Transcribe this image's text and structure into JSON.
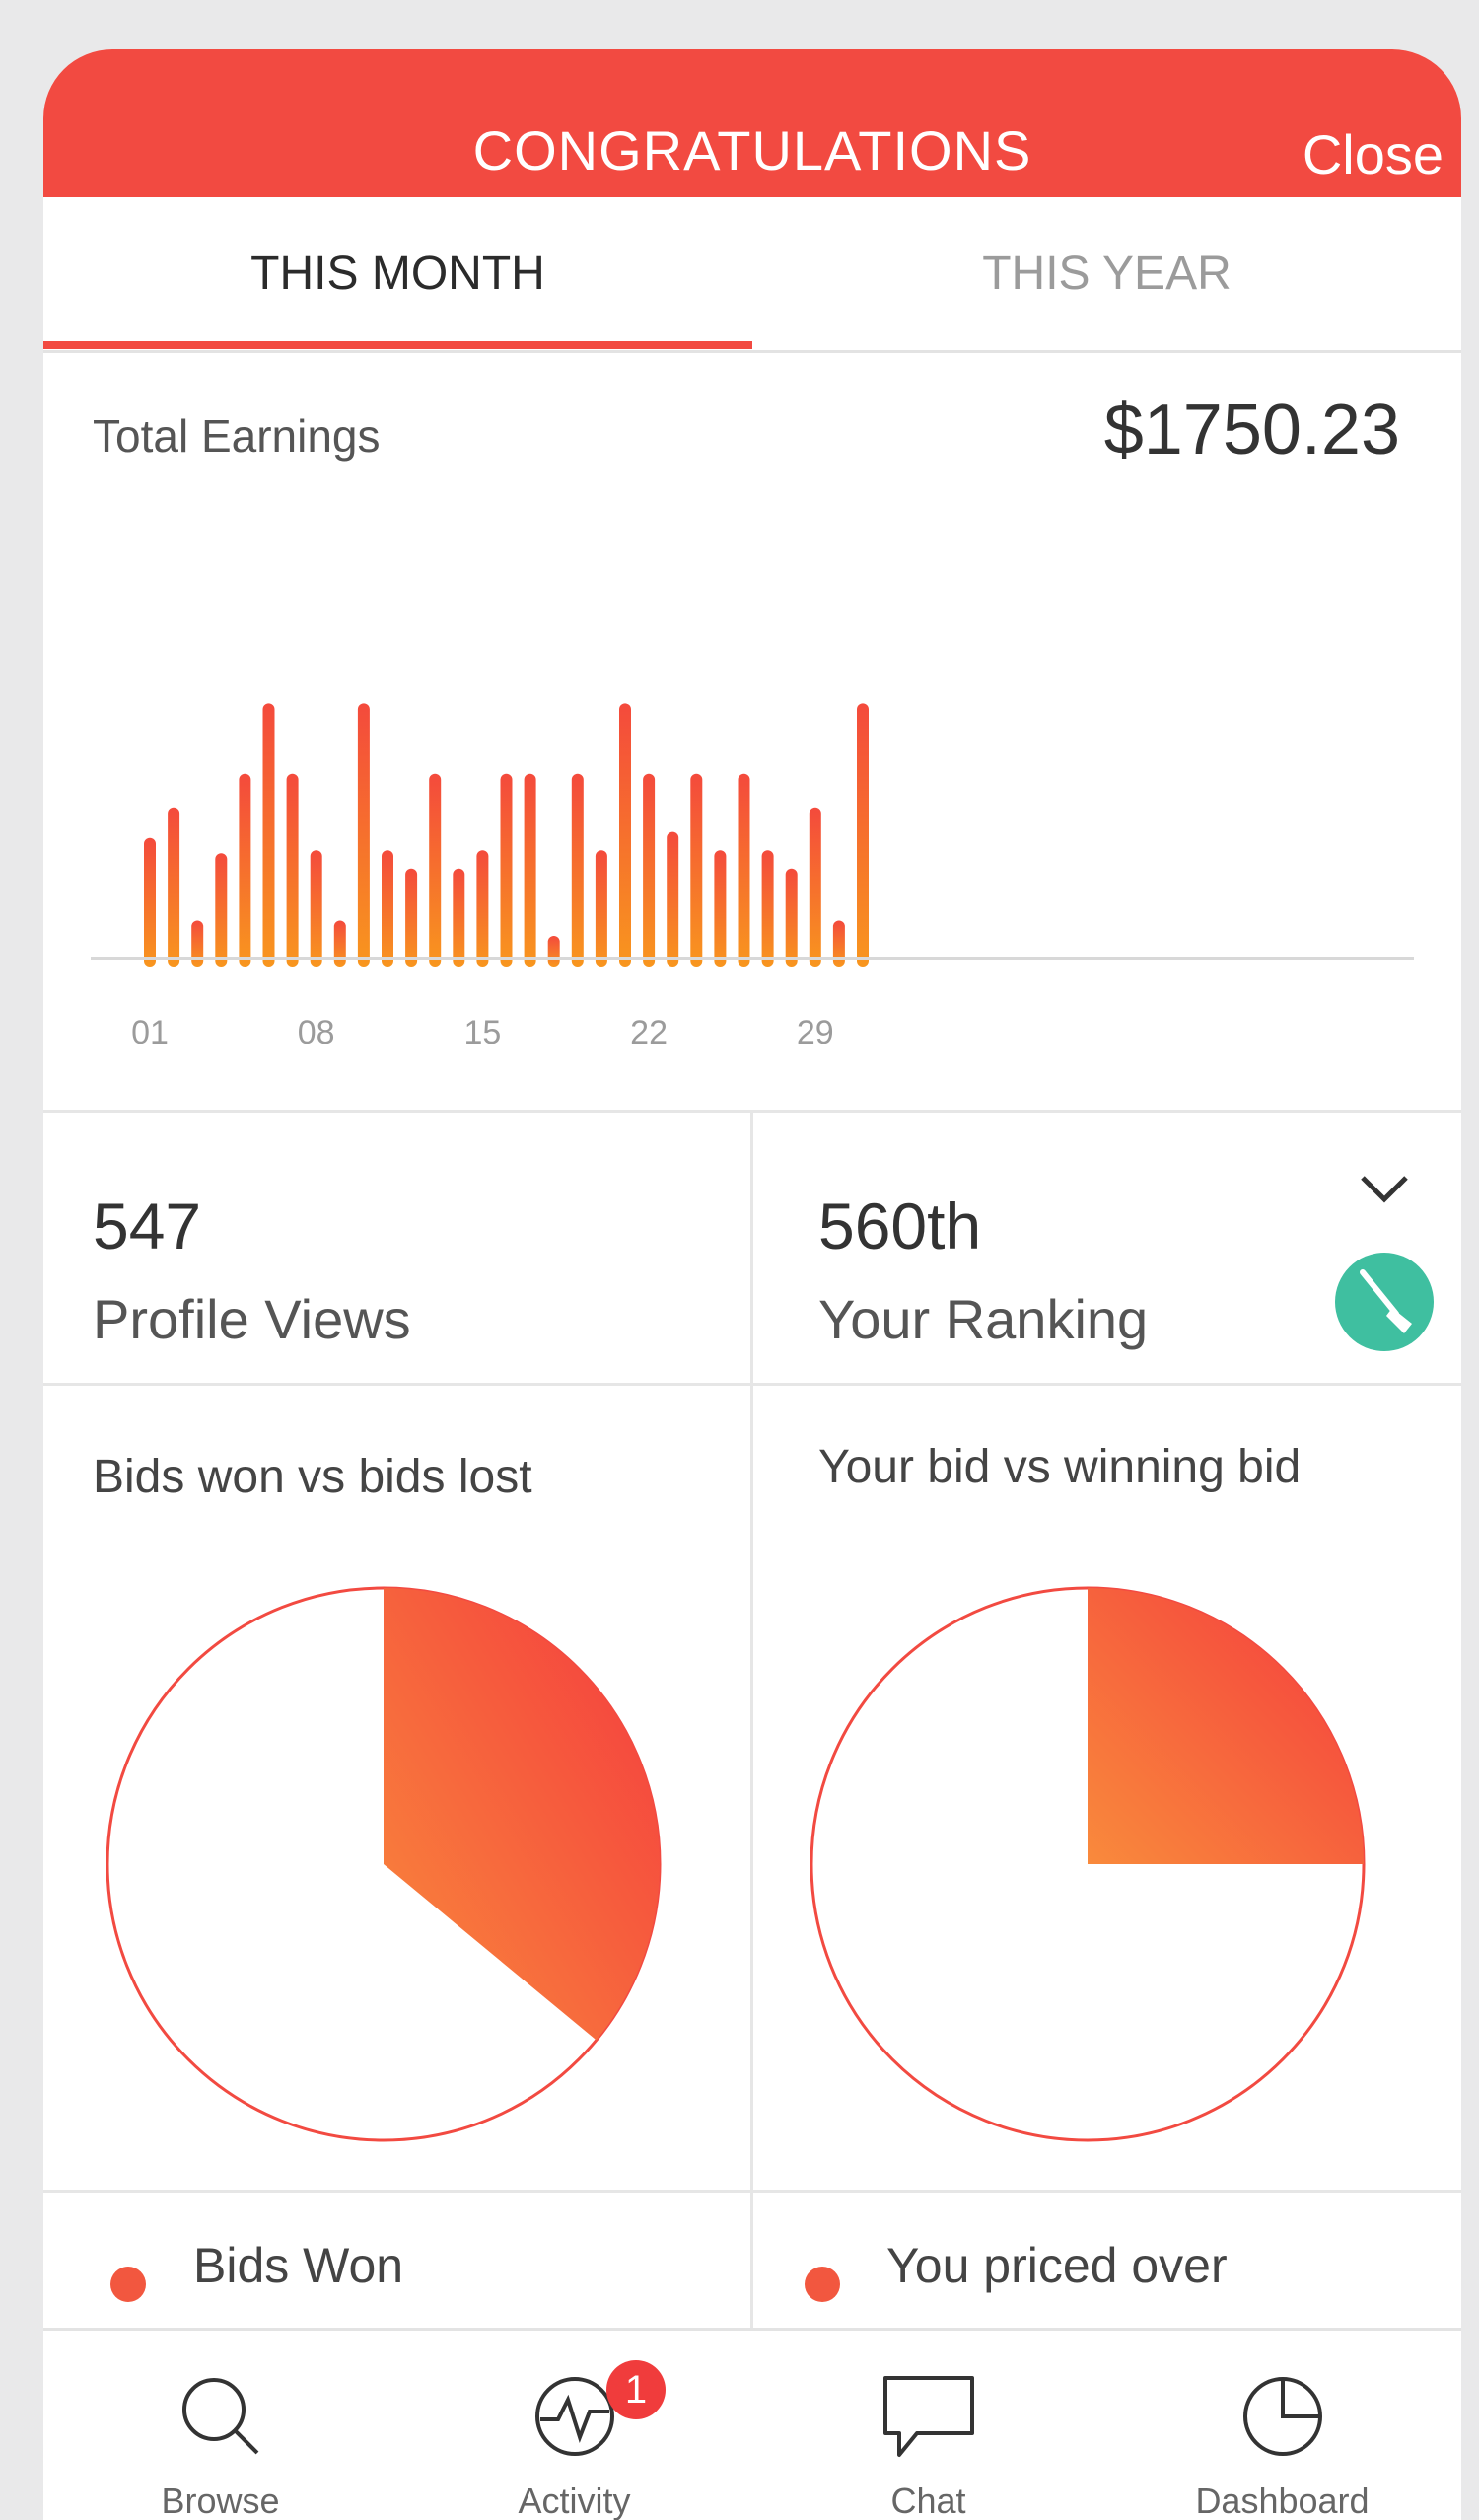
{
  "header": {
    "title": "CONGRATULATIONS",
    "close_label": "Close"
  },
  "tabs": [
    {
      "label": "THIS MONTH",
      "active": true
    },
    {
      "label": "THIS YEAR",
      "active": false
    }
  ],
  "earnings": {
    "label": "Total Earnings",
    "value": "$1750.23"
  },
  "chart_data": {
    "type": "bar",
    "title": "",
    "xlabel": "",
    "ylabel": "",
    "tick_labels": [
      "01",
      "08",
      "15",
      "22",
      "29"
    ],
    "categories": [
      "01",
      "02",
      "03",
      "04",
      "05",
      "06",
      "07",
      "08",
      "09",
      "10",
      "11",
      "12",
      "13",
      "14",
      "15",
      "16",
      "17",
      "18",
      "19",
      "20",
      "21",
      "22",
      "23",
      "24",
      "25",
      "26",
      "27",
      "28",
      "29",
      "30"
    ],
    "values": [
      42,
      52,
      15,
      37,
      63,
      86,
      63,
      38,
      15,
      86,
      38,
      32,
      63,
      32,
      38,
      63,
      63,
      10,
      63,
      38,
      86,
      63,
      44,
      63,
      38,
      63,
      38,
      32,
      52,
      15,
      86
    ],
    "ylim": [
      0,
      100
    ],
    "grid": false,
    "colors": {
      "top": "#f44a3c",
      "bottom": "#f8961e"
    }
  },
  "stats": {
    "profile_views": {
      "value": "547",
      "label": "Profile Views"
    },
    "ranking": {
      "value": "560th",
      "label": "Your Ranking",
      "badge_icon": "broom-icon",
      "chevron_icon": "chevron-down-icon"
    }
  },
  "pies": {
    "bids": {
      "title": "Bids won vs bids lost",
      "won_fraction": 0.36,
      "legend": [
        {
          "label": "Bids Won",
          "color": "#f2573f"
        }
      ]
    },
    "price": {
      "title": "Your bid vs winning bid",
      "over_fraction": 0.25,
      "legend": [
        {
          "label": "You priced over",
          "color": "#f2573f"
        }
      ]
    }
  },
  "nav": [
    {
      "label": "Browse",
      "icon": "search-icon"
    },
    {
      "label": "Activity",
      "icon": "activity-icon",
      "badge": "1"
    },
    {
      "label": "Chat",
      "icon": "chat-icon"
    },
    {
      "label": "Dashboard",
      "icon": "pie-chart-icon"
    }
  ],
  "accent": "#f24a41"
}
